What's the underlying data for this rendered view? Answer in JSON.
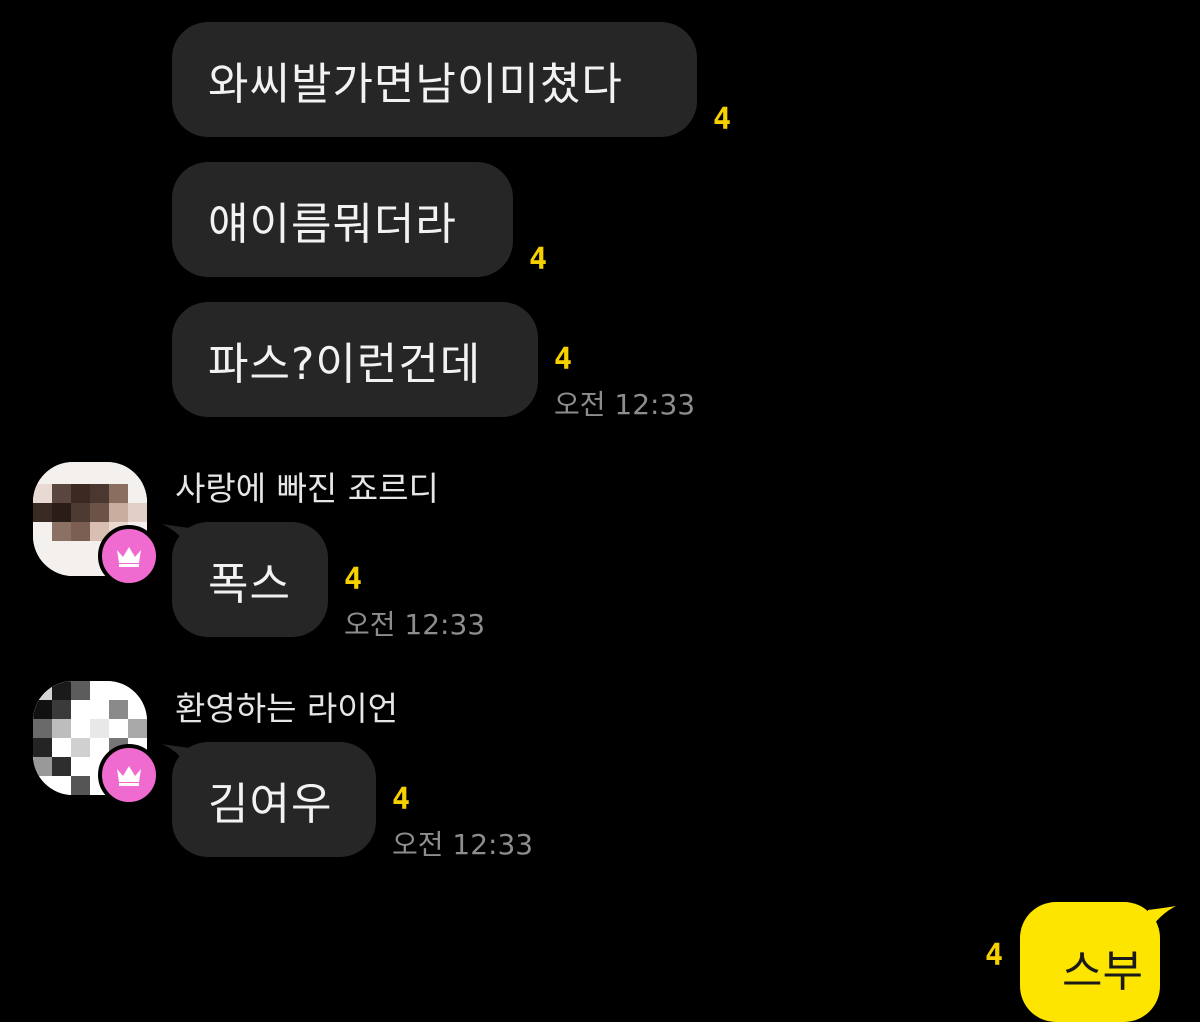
{
  "messages": [
    {
      "text": "와씨발가면남이미쳤다",
      "unread": "4"
    },
    {
      "text": "얘이름뭐더라",
      "unread": "4"
    },
    {
      "text": "파스?이런건데",
      "unread": "4",
      "time": "오전 12:33"
    },
    {
      "sender": "사랑에 빠진 죠르디",
      "text": "폭스",
      "unread": "4",
      "time": "오전 12:33"
    },
    {
      "sender": "환영하는 라이언",
      "text": "김여우",
      "unread": "4",
      "time": "오전 12:33"
    }
  ],
  "my_message": {
    "text": "스부",
    "unread": "4"
  },
  "colors": {
    "background": "#000000",
    "bubble": "#262626",
    "my_bubble": "#fee500",
    "unread": "#f7d000",
    "badge": "#f06bd0"
  },
  "icons": {
    "badge": "crown-icon"
  }
}
